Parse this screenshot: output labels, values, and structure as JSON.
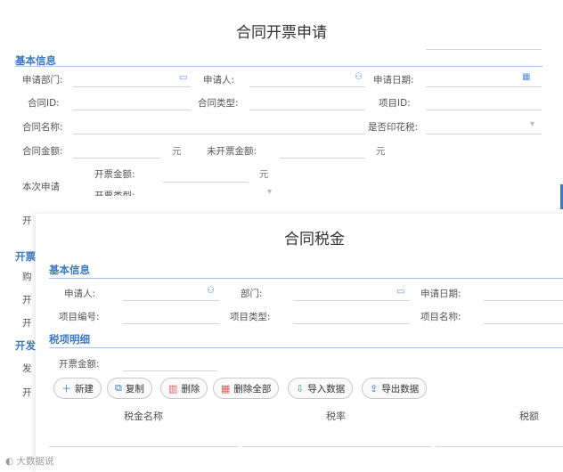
{
  "main": {
    "title": "合同开票申请",
    "section_basic": "基本信息",
    "fields": {
      "dept": "申请部门:",
      "applicant": "申请人:",
      "date": "申请日期:",
      "contract_id": "合同ID:",
      "contract_type": "合同类型:",
      "project_id": "项目ID:",
      "contract_name": "合同名称:",
      "stamp_tax": "是否印花税:",
      "contract_amount": "合同金额:",
      "unbilled_amount": "未开票金额:",
      "current_apply": "本次申请",
      "invoice_amount": "开票金额:",
      "invoice_type": "开票类型:"
    },
    "unit": "元",
    "partial": {
      "kai1": "开",
      "kaipiao": "开票",
      "gou": "购",
      "kai2": "开",
      "kai3": "开",
      "kaifa": "开发",
      "fa": "发",
      "kai4": "开"
    }
  },
  "dialog": {
    "title": "合同税金",
    "section_basic": "基本信息",
    "section_tax": "税项明细",
    "fields": {
      "applicant": "申请人:",
      "dept": "部门:",
      "date": "申请日期:",
      "project_no": "项目编号:",
      "project_type": "项目类型:",
      "project_name": "项目名称:",
      "invoice_amount": "开票金额:"
    },
    "buttons": {
      "new": "新建",
      "copy": "复制",
      "delete": "删除",
      "delete_all": "删除全部",
      "import": "导入数据",
      "export": "导出数据"
    },
    "columns": [
      "税金名称",
      "税率",
      "税额"
    ]
  },
  "watermark": "大数据说",
  "colors": {
    "accent": "#3c78c3",
    "section_line": "#a8c6ea"
  }
}
